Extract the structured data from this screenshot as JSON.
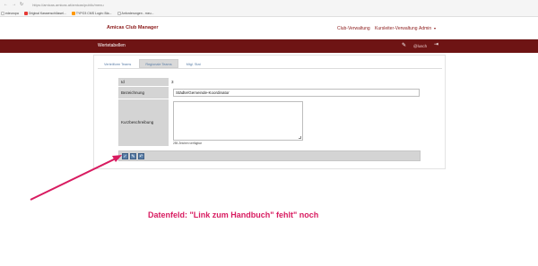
{
  "browser": {
    "url": "https://amicas.amicas.at/amicas/public/menu",
    "bookmarks": [
      {
        "label": "edeuropa",
        "color": "#ffffff"
      },
      {
        "label": "Original Kassenschlüssel...",
        "color": "#e53935"
      },
      {
        "label": "TYPO3 CMS Login: Bla...",
        "color": "#ff9800"
      },
      {
        "label": "Anforderungen - meu...",
        "color": "#eeeeee"
      }
    ]
  },
  "header": {
    "brand": "Amicas Club Manager",
    "nav": {
      "club": "Club-Verwaltung",
      "courses": "Kursleiter-Verwaltung",
      "admin": "Admin"
    }
  },
  "subheader": {
    "title": "Wertetabellen",
    "user": "@lusch"
  },
  "tabs": [
    {
      "label": "Verteilform Teams",
      "active": false
    },
    {
      "label": "Regionale Teams",
      "active": true
    },
    {
      "label": "Mtgl. Stat",
      "active": false
    }
  ],
  "form": {
    "id_label": "Id",
    "id_value": "3",
    "name_label": "Bezeichnung",
    "name_value": "Städte/Gemeinde-Koordinator",
    "desc_label": "Kurzbeschreibung",
    "desc_hint": "255 Zeichen verfügbar"
  },
  "buttons": [
    {
      "name": "save",
      "glyph": "✓"
    },
    {
      "name": "edit",
      "glyph": "✎"
    },
    {
      "name": "back",
      "glyph": "↶"
    }
  ],
  "annotation": {
    "text": "Datenfeld: \"Link zum Handbuch\" fehlt\" noch",
    "color": "#d81b60"
  },
  "colors": {
    "brand": "#8b1a1a",
    "subheader": "#6e1414",
    "tab_text": "#5a7ea8"
  }
}
